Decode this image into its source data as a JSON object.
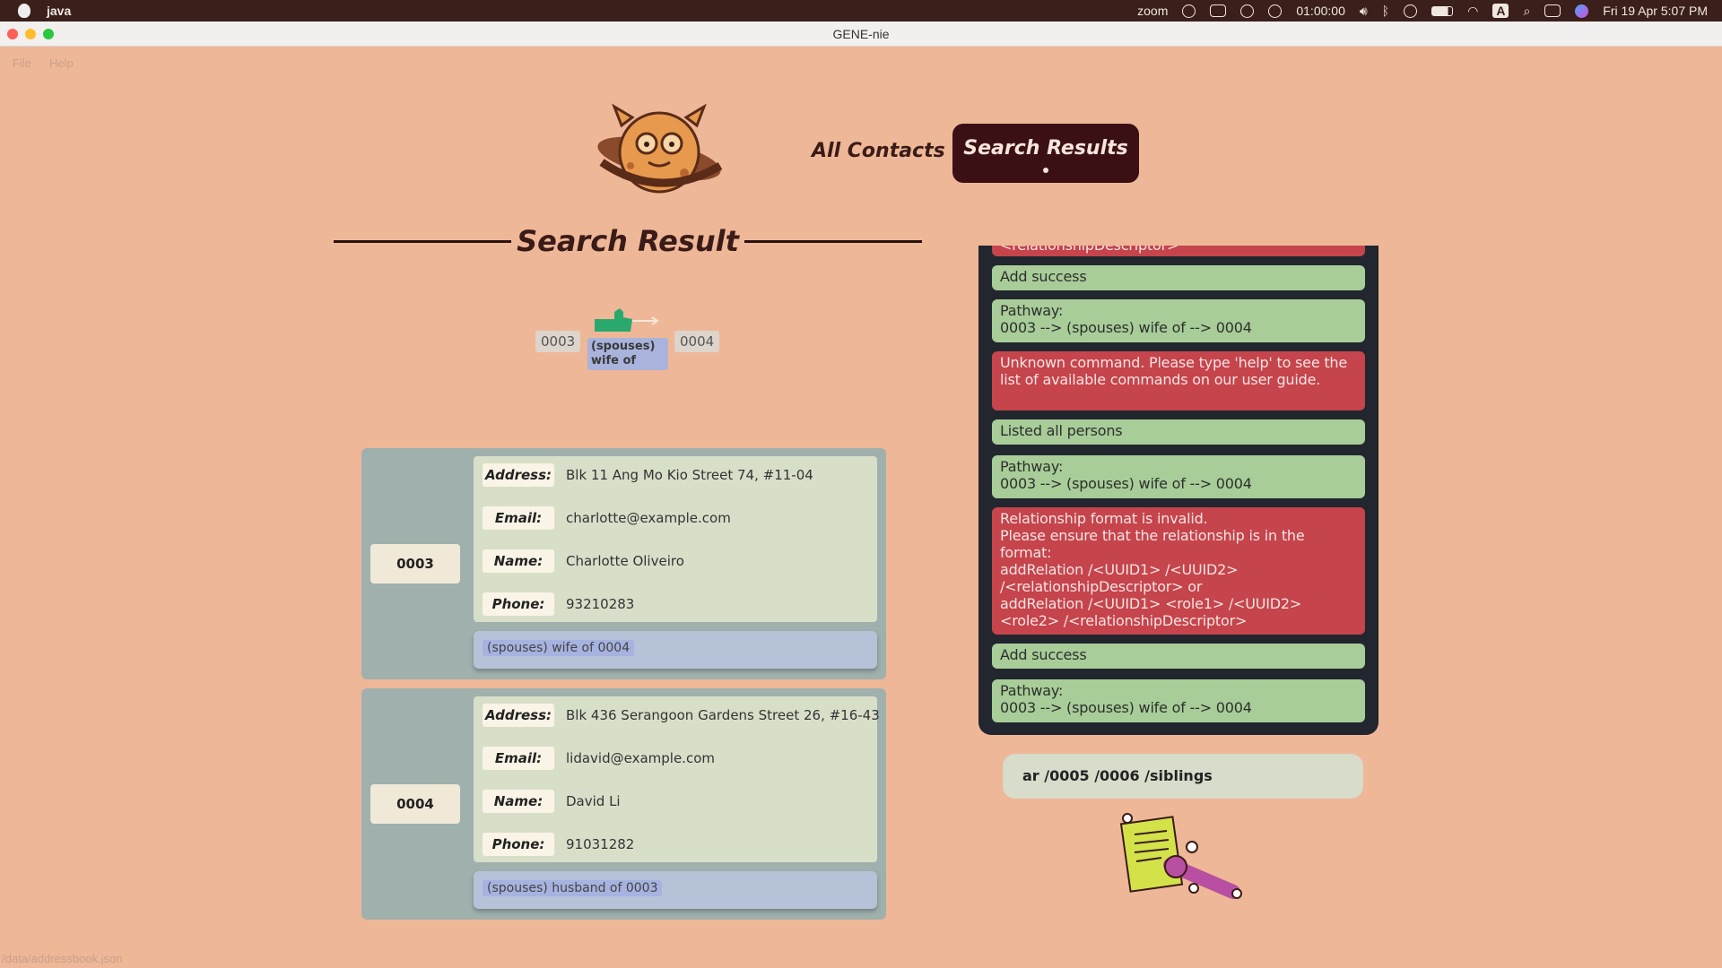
{
  "menubar": {
    "app_name": "java",
    "zoom_label": "zoom",
    "timer": "01:00:00",
    "datetime": "Fri 19 Apr  5:07 PM",
    "input_badge": "A"
  },
  "window": {
    "title": "GENE-nie"
  },
  "app_menu": {
    "file": "File",
    "help": "Help"
  },
  "nav": {
    "all_contacts": "All Contacts",
    "search_results": "Search Results",
    "active": "Search Results"
  },
  "heading": "Search Result",
  "graph": {
    "from_node": "0003",
    "to_node": "0004",
    "edge_label": "(spouses)\nwife of"
  },
  "contacts": [
    {
      "id": "0003",
      "address_label": "Address:",
      "address": "Blk 11 Ang Mo Kio Street 74, #11-04",
      "email_label": "Email:",
      "email": "charlotte@example.com",
      "name_label": "Name:",
      "name": "Charlotte Oliveiro",
      "phone_label": "Phone:",
      "phone": "93210283",
      "relation": "(spouses) wife of 0004"
    },
    {
      "id": "0004",
      "address_label": "Address:",
      "address": "Blk 436 Serangoon Gardens Street 26, #16-43",
      "email_label": "Email:",
      "email": "lidavid@example.com",
      "name_label": "Name:",
      "name": "David Li",
      "phone_label": "Phone:",
      "phone": "91031282",
      "relation": "(spouses) husband of 0003"
    }
  ],
  "results": [
    {
      "status": "error",
      "text": "<relationshipDescriptor>"
    },
    {
      "status": "success",
      "text": "Add success"
    },
    {
      "status": "success",
      "text": "Pathway:\n0003 --> (spouses) wife of  --> 0004"
    },
    {
      "status": "error",
      "text": "Unknown command. Please type 'help' to see the list of available commands on our user guide."
    },
    {
      "status": "success",
      "text": "Listed all persons"
    },
    {
      "status": "success",
      "text": "Pathway:\n0003 --> (spouses) wife of  --> 0004"
    },
    {
      "status": "error",
      "text": "Relationship format is invalid.\nPlease ensure that the relationship is in the format:\naddRelation /<UUID1> /<UUID2> /<relationshipDescriptor> or\naddRelation /<UUID1> <role1> /<UUID2> <role2> /<relationshipDescriptor>"
    },
    {
      "status": "success",
      "text": "Add success"
    },
    {
      "status": "success",
      "text": "Pathway:\n0003 --> (spouses) wife of  --> 0004"
    }
  ],
  "command_box": {
    "value": "ar /0005 /0006 /siblings"
  },
  "status_bar": {
    "path": "/data/addressbook.json"
  },
  "colors": {
    "background": "#eeb797",
    "nav_active": "#3a1014",
    "success": "#a8cd98",
    "error": "#c6444b",
    "panel": "#22262e"
  }
}
